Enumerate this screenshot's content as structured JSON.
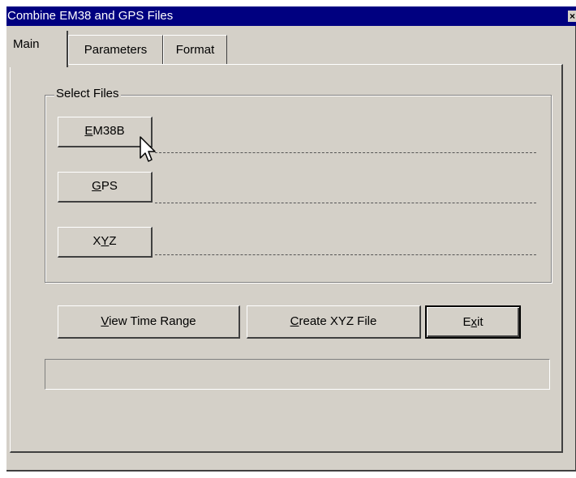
{
  "window": {
    "title": "Combine EM38 and GPS Files",
    "close_glyph": "×"
  },
  "tabs": [
    {
      "label": "Main",
      "active": true
    },
    {
      "label": "Parameters",
      "active": false
    },
    {
      "label": "Format",
      "active": false
    }
  ],
  "select_files": {
    "title": "Select Files",
    "buttons": [
      {
        "pre": "",
        "mnemonic": "E",
        "post": "M38B",
        "path": ""
      },
      {
        "pre": "",
        "mnemonic": "G",
        "post": "PS",
        "path": ""
      },
      {
        "pre": "X",
        "mnemonic": "Y",
        "post": "Z",
        "path": ""
      }
    ]
  },
  "actions": {
    "view_time_range": {
      "pre": "",
      "mnemonic": "V",
      "post": "iew Time Range"
    },
    "create_xyz": {
      "pre": "",
      "mnemonic": "C",
      "post": "reate XYZ File"
    },
    "exit": {
      "pre": "E",
      "mnemonic": "x",
      "post": "it"
    }
  },
  "status": {
    "text": ""
  },
  "icons": {
    "close": "close-icon",
    "cursor": "cursor-icon"
  }
}
